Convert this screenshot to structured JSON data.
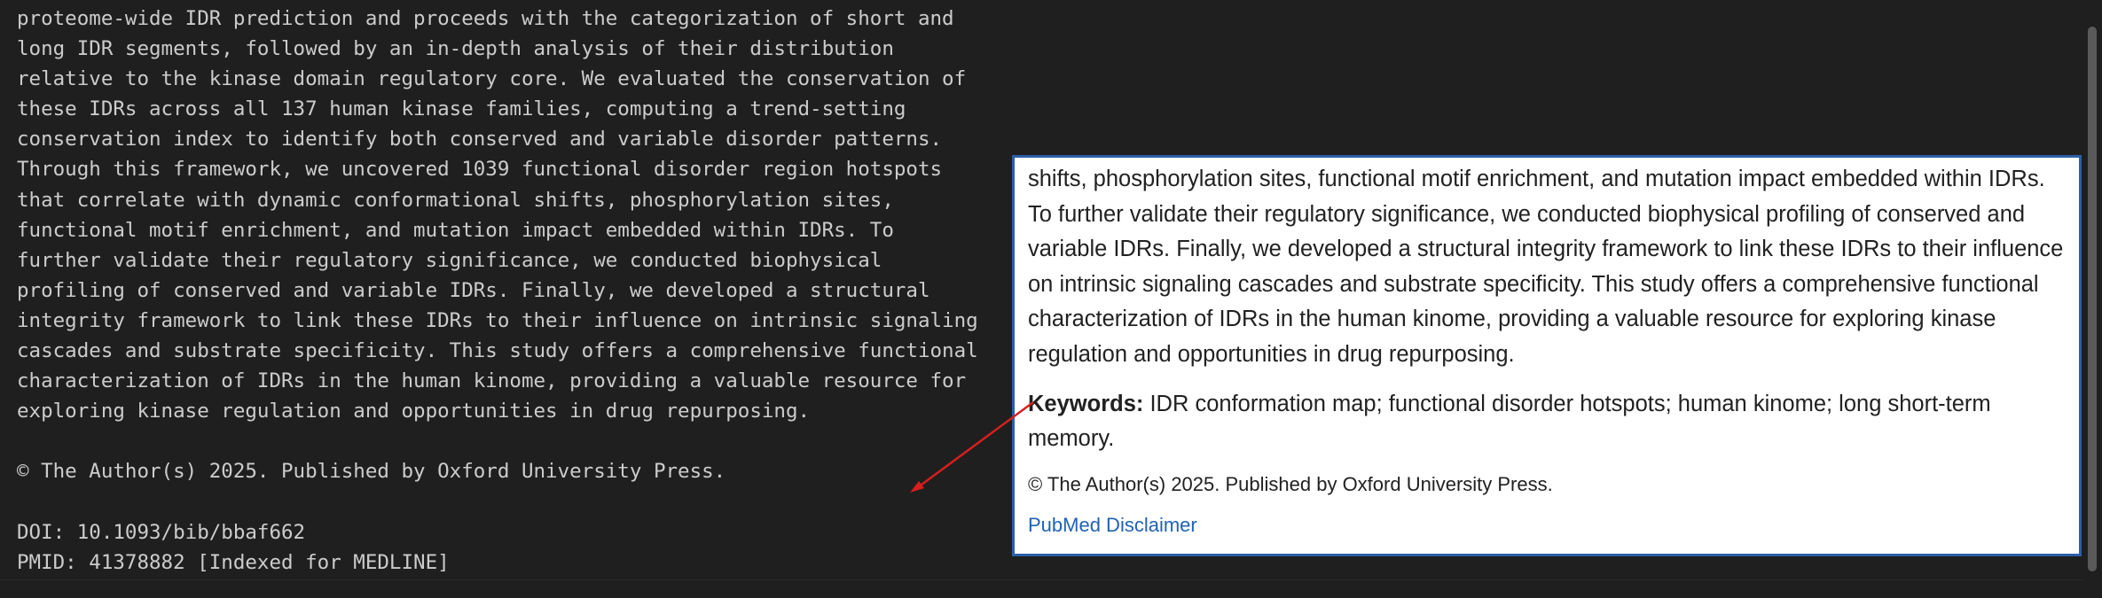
{
  "editor": {
    "lines": [
      "proteome-wide IDR prediction and proceeds with the categorization of short and",
      "long IDR segments, followed by an in-depth analysis of their distribution",
      "relative to the kinase domain regulatory core. We evaluated the conservation of",
      "these IDRs across all 137 human kinase families, computing a trend-setting",
      "conservation index to identify both conserved and variable disorder patterns.",
      "Through this framework, we uncovered 1039 functional disorder region hotspots",
      "that correlate with dynamic conformational shifts, phosphorylation sites,",
      "functional motif enrichment, and mutation impact embedded within IDRs. To",
      "further validate their regulatory significance, we conducted biophysical",
      "profiling of conserved and variable IDRs. Finally, we developed a structural",
      "integrity framework to link these IDRs to their influence on intrinsic signaling",
      "cascades and substrate specificity. This study offers a comprehensive functional",
      "characterization of IDRs in the human kinome, providing a valuable resource for",
      "exploring kinase regulation and opportunities in drug repurposing.",
      "",
      "© The Author(s) 2025. Published by Oxford University Press.",
      "",
      "DOI: 10.1093/bib/bbaf662",
      "PMID: 41378882 [Indexed for MEDLINE]"
    ]
  },
  "popup": {
    "abstract": "shifts, phosphorylation sites, functional motif enrichment, and mutation impact embedded within IDRs. To further validate their regulatory significance, we conducted biophysical profiling of conserved and variable IDRs. Finally, we developed a structural integrity framework to link these IDRs to their influence on intrinsic signaling cascades and substrate specificity. This study offers a comprehensive functional characterization of IDRs in the human kinome, providing a valuable resource for exploring kinase regulation and opportunities in drug repurposing.",
    "keywords_label": "Keywords:",
    "keywords": "IDR conformation map; functional disorder hotspots; human kinome; long short-term memory.",
    "copyright": "© The Author(s) 2025. Published by Oxford University Press.",
    "disclaimer_link": "PubMed Disclaimer"
  },
  "colors": {
    "editor_bg": "#1f1f1f",
    "editor_text": "#cccccc",
    "popup_border": "#2c5fa8",
    "link": "#2062b5",
    "arrow": "#d81e1e"
  }
}
